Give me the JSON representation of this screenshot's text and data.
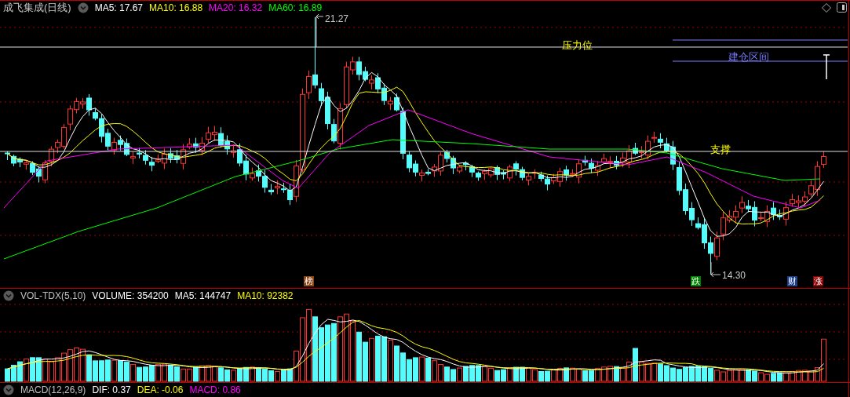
{
  "main_panel": {
    "title": "成飞集成(日线)",
    "indicators": [
      {
        "label": "MA5: 17.67",
        "color": "#ffffff"
      },
      {
        "label": "MA10: 16.88",
        "color": "#ffff00"
      },
      {
        "label": "MA20: 16.32",
        "color": "#ff00ff"
      },
      {
        "label": "MA60: 16.89",
        "color": "#00ff00"
      }
    ],
    "high_label": "21.27",
    "low_label": "14.30",
    "level_lines": [
      {
        "kind": "resistance",
        "label": "压力位"
      },
      {
        "kind": "support",
        "label": "支撑"
      },
      {
        "kind": "range",
        "label": "建仓区间"
      }
    ],
    "event_markers": [
      {
        "label": "榜",
        "color": "#8b4513"
      },
      {
        "label": "跌",
        "color": "#008000"
      },
      {
        "label": "财",
        "color": "#1e3f8a"
      },
      {
        "label": "涨",
        "color": "#8b0000"
      }
    ]
  },
  "volume_panel": {
    "indicators": [
      {
        "label": "VOL-TDX(5,10)",
        "color": "#c0c0c0"
      },
      {
        "label": "VOLUME: 354200",
        "color": "#ffffff"
      },
      {
        "label": "MA5: 144747",
        "color": "#ffffff"
      },
      {
        "label": "MA10: 92382",
        "color": "#ffff00"
      }
    ]
  },
  "macd_panel": {
    "indicators": [
      {
        "label": "MACD(12,26,9)",
        "color": "#c0c0c0"
      },
      {
        "label": "DIF: 0.37",
        "color": "#ffffff"
      },
      {
        "label": "DEA: -0.06",
        "color": "#ffff00"
      },
      {
        "label": "MACD: 0.86",
        "color": "#ff00ff"
      }
    ]
  }
}
